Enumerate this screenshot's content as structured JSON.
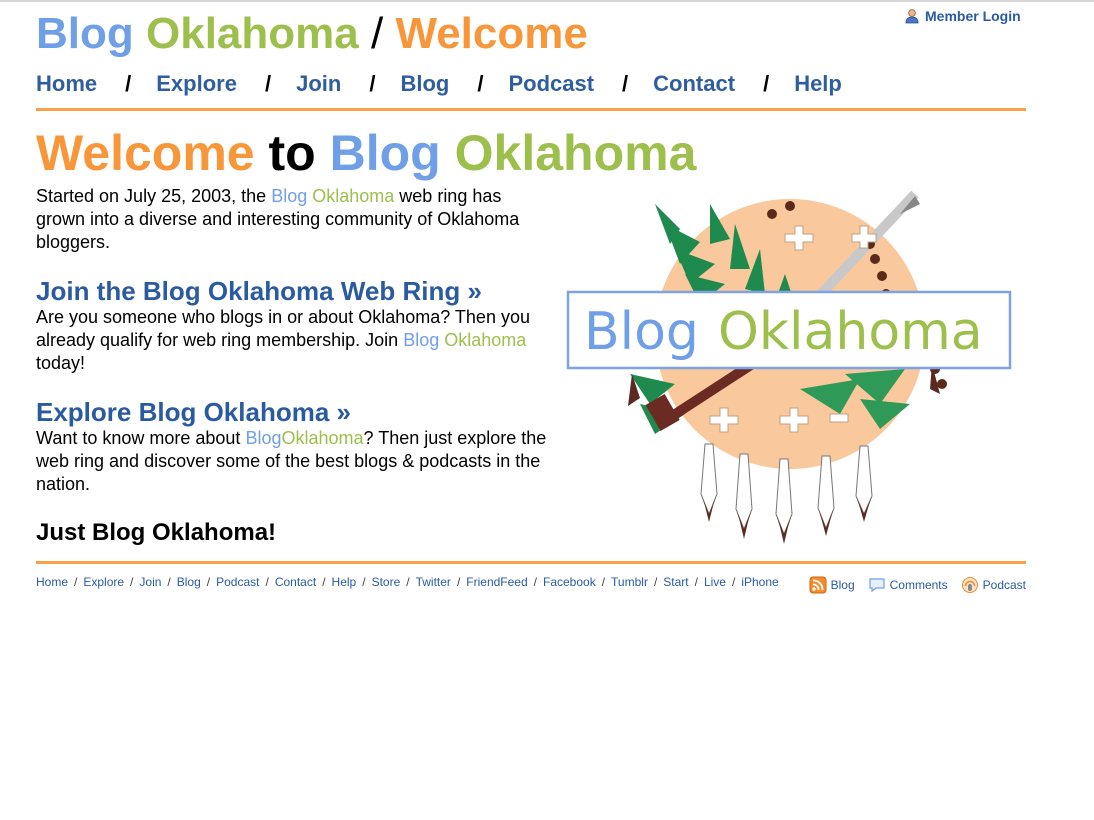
{
  "header": {
    "title_part1": "Blog",
    "title_part2": "Oklahoma",
    "title_sep": "/",
    "title_part3": "Welcome",
    "member_login": "Member Login"
  },
  "nav": {
    "items": [
      "Home",
      "Explore",
      "Join",
      "Blog",
      "Podcast",
      "Contact",
      "Help"
    ],
    "separator": "/"
  },
  "main": {
    "heading_welcome": "Welcome",
    "heading_to": "to",
    "heading_blog": "Blog",
    "heading_oklahoma": "Oklahoma",
    "intro_before": "Started on July 25, 2003, the",
    "intro_blog": "Blog",
    "intro_oklahoma": "Oklahoma",
    "intro_after": "web ring has grown into a diverse and interesting community of Oklahoma bloggers.",
    "join_heading": "Join the Blog Oklahoma Web Ring »",
    "join_before": "Are you someone who blogs in or about Oklahoma? Then you already qualify for web ring membership. Join",
    "join_blog": "Blog",
    "join_oklahoma": "Oklahoma",
    "join_after": "today!",
    "explore_heading": "Explore Blog Oklahoma »",
    "explore_before": "Want to know more about",
    "explore_blog": "Blog",
    "explore_oklahoma": "Oklahoma",
    "explore_after": "? Then just explore the web ring and discover some of the best blogs & podcasts in the nation.",
    "tagline": "Just Blog Oklahoma!"
  },
  "logo": {
    "text_blog": "Blog",
    "text_oklahoma": "Oklahoma"
  },
  "footer": {
    "links": [
      "Home",
      "Explore",
      "Join",
      "Blog",
      "Podcast",
      "Contact",
      "Help",
      "Store",
      "Twitter",
      "FriendFeed",
      "Facebook",
      "Tumblr",
      "Start",
      "Live",
      "iPhone"
    ],
    "separator": "/",
    "feeds": {
      "blog": "Blog",
      "comments": "Comments",
      "podcast": "Podcast"
    }
  },
  "colors": {
    "blue": "#6f9fe6",
    "green": "#9dbf4c",
    "orange": "#f8963a",
    "navy": "#2a5aa0"
  }
}
